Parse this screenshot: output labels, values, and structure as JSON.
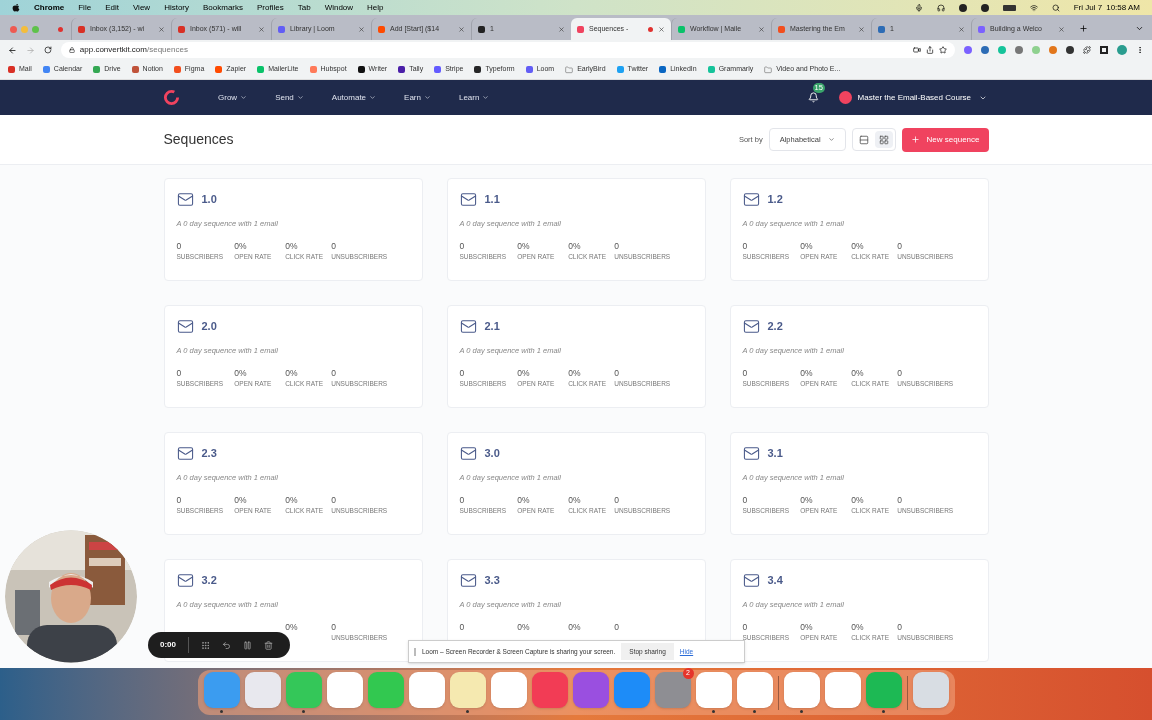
{
  "menu_bar": {
    "app": "Chrome",
    "items": [
      "File",
      "Edit",
      "View",
      "History",
      "Bookmarks",
      "Profiles",
      "Tab",
      "Window",
      "Help"
    ],
    "date": "Fri Jul 7",
    "time": "10:58 AM"
  },
  "tabs": [
    {
      "kind": "pinned",
      "color": "#e0312f",
      "selected": false
    },
    {
      "kind": "page",
      "title": "Inbox (3,152) - wi",
      "color": "#d93025",
      "recording": false,
      "selected": false
    },
    {
      "kind": "page",
      "title": "Inbox (571) - will",
      "color": "#d93025",
      "recording": false,
      "selected": false
    },
    {
      "kind": "page",
      "title": "Library | Loom",
      "color": "#625df5",
      "recording": false,
      "selected": false
    },
    {
      "kind": "page",
      "title": "Add [Start] ($14",
      "color": "#ff4a00",
      "recording": false,
      "selected": false
    },
    {
      "kind": "page",
      "title": "1",
      "color": "#222222",
      "recording": false,
      "selected": false
    },
    {
      "kind": "page",
      "title": "Sequences - ",
      "color": "#f0435f",
      "recording": true,
      "selected": true
    },
    {
      "kind": "page",
      "title": "Workflow | Maile",
      "color": "#09c269",
      "recording": false,
      "selected": false
    },
    {
      "kind": "page",
      "title": "Mastering the Em",
      "color": "#f24e1e",
      "recording": false,
      "selected": false
    },
    {
      "kind": "page",
      "title": "1",
      "color": "#2d6cb5",
      "recording": false,
      "selected": false
    },
    {
      "kind": "page",
      "title": "Building a Welco",
      "color": "#7b61ff",
      "recording": false,
      "selected": false
    }
  ],
  "address_bar": {
    "host": "app.convertkit.com",
    "path": "/sequences"
  },
  "bookmarks": [
    {
      "kind": "site",
      "label": "Mail",
      "color": "#d93025"
    },
    {
      "kind": "site",
      "label": "Calendar",
      "color": "#4285f4"
    },
    {
      "kind": "site",
      "label": "Drive",
      "color": "#34a853"
    },
    {
      "kind": "site",
      "label": "Notion",
      "color": "#c0533a"
    },
    {
      "kind": "site",
      "label": "Figma",
      "color": "#f24e1e"
    },
    {
      "kind": "site",
      "label": "Zapier",
      "color": "#ff4a00"
    },
    {
      "kind": "site",
      "label": "MailerLite",
      "color": "#09c269"
    },
    {
      "kind": "site",
      "label": "Hubspot",
      "color": "#ff7a59"
    },
    {
      "kind": "site",
      "label": "Writer",
      "color": "#111111"
    },
    {
      "kind": "site",
      "label": "Tally",
      "color": "#4b1fa8"
    },
    {
      "kind": "site",
      "label": "Stripe",
      "color": "#635bff"
    },
    {
      "kind": "site",
      "label": "Typeform",
      "color": "#262627"
    },
    {
      "kind": "site",
      "label": "Loom",
      "color": "#625df5"
    },
    {
      "kind": "folder",
      "label": "EarlyBird"
    },
    {
      "kind": "site",
      "label": "Twitter",
      "color": "#1da1f2"
    },
    {
      "kind": "site",
      "label": "LinkedIn",
      "color": "#0a66c2"
    },
    {
      "kind": "site",
      "label": "Grammarly",
      "color": "#15c39a"
    },
    {
      "kind": "folder",
      "label": "Video and Photo E..."
    }
  ],
  "nav": {
    "items": [
      "Grow",
      "Send",
      "Automate",
      "Earn",
      "Learn"
    ],
    "notifications": "15",
    "account": "Master the Email-Based Course"
  },
  "header": {
    "title": "Sequences",
    "sort_label": "Sort by",
    "sort_value": "Alphabetical",
    "views": [
      {
        "kind": "list",
        "selected": false
      },
      {
        "kind": "grid",
        "selected": true
      }
    ],
    "new_button": "New sequence"
  },
  "sequences": [
    {
      "title": "1.0",
      "description": "A 0 day sequence with 1 email",
      "stats": [
        {
          "kind": "subscribers",
          "value": "0",
          "label": "SUBSCRIBERS"
        },
        {
          "kind": "open_rate",
          "value": "0%",
          "label": "OPEN RATE"
        },
        {
          "kind": "click_rate",
          "value": "0%",
          "label": "CLICK RATE"
        },
        {
          "kind": "unsubscribers",
          "value": "0",
          "label": "UNSUBSCRIBERS"
        }
      ]
    },
    {
      "title": "1.1",
      "description": "A 0 day sequence with 1 email",
      "stats": [
        {
          "kind": "subscribers",
          "value": "0",
          "label": "SUBSCRIBERS"
        },
        {
          "kind": "open_rate",
          "value": "0%",
          "label": "OPEN RATE"
        },
        {
          "kind": "click_rate",
          "value": "0%",
          "label": "CLICK RATE"
        },
        {
          "kind": "unsubscribers",
          "value": "0",
          "label": "UNSUBSCRIBERS"
        }
      ]
    },
    {
      "title": "1.2",
      "description": "A 0 day sequence with 1 email",
      "stats": [
        {
          "kind": "subscribers",
          "value": "0",
          "label": "SUBSCRIBERS"
        },
        {
          "kind": "open_rate",
          "value": "0%",
          "label": "OPEN RATE"
        },
        {
          "kind": "click_rate",
          "value": "0%",
          "label": "CLICK RATE"
        },
        {
          "kind": "unsubscribers",
          "value": "0",
          "label": "UNSUBSCRIBERS"
        }
      ]
    },
    {
      "title": "2.0",
      "description": "A 0 day sequence with 1 email",
      "stats": [
        {
          "kind": "subscribers",
          "value": "0",
          "label": "SUBSCRIBERS"
        },
        {
          "kind": "open_rate",
          "value": "0%",
          "label": "OPEN RATE"
        },
        {
          "kind": "click_rate",
          "value": "0%",
          "label": "CLICK RATE"
        },
        {
          "kind": "unsubscribers",
          "value": "0",
          "label": "UNSUBSCRIBERS"
        }
      ]
    },
    {
      "title": "2.1",
      "description": "A 0 day sequence with 1 email",
      "stats": [
        {
          "kind": "subscribers",
          "value": "0",
          "label": "SUBSCRIBERS"
        },
        {
          "kind": "open_rate",
          "value": "0%",
          "label": "OPEN RATE"
        },
        {
          "kind": "click_rate",
          "value": "0%",
          "label": "CLICK RATE"
        },
        {
          "kind": "unsubscribers",
          "value": "0",
          "label": "UNSUBSCRIBERS"
        }
      ]
    },
    {
      "title": "2.2",
      "description": "A 0 day sequence with 1 email",
      "stats": [
        {
          "kind": "subscribers",
          "value": "0",
          "label": "SUBSCRIBERS"
        },
        {
          "kind": "open_rate",
          "value": "0%",
          "label": "OPEN RATE"
        },
        {
          "kind": "click_rate",
          "value": "0%",
          "label": "CLICK RATE"
        },
        {
          "kind": "unsubscribers",
          "value": "0",
          "label": "UNSUBSCRIBERS"
        }
      ]
    },
    {
      "title": "2.3",
      "description": "A 0 day sequence with 1 email",
      "stats": [
        {
          "kind": "subscribers",
          "value": "0",
          "label": "SUBSCRIBERS"
        },
        {
          "kind": "open_rate",
          "value": "0%",
          "label": "OPEN RATE"
        },
        {
          "kind": "click_rate",
          "value": "0%",
          "label": "CLICK RATE"
        },
        {
          "kind": "unsubscribers",
          "value": "0",
          "label": "UNSUBSCRIBERS"
        }
      ]
    },
    {
      "title": "3.0",
      "description": "A 0 day sequence with 1 email",
      "stats": [
        {
          "kind": "subscribers",
          "value": "0",
          "label": "SUBSCRIBERS"
        },
        {
          "kind": "open_rate",
          "value": "0%",
          "label": "OPEN RATE"
        },
        {
          "kind": "click_rate",
          "value": "0%",
          "label": "CLICK RATE"
        },
        {
          "kind": "unsubscribers",
          "value": "0",
          "label": "UNSUBSCRIBERS"
        }
      ]
    },
    {
      "title": "3.1",
      "description": "A 0 day sequence with 1 email",
      "stats": [
        {
          "kind": "subscribers",
          "value": "0",
          "label": "SUBSCRIBERS"
        },
        {
          "kind": "open_rate",
          "value": "0%",
          "label": "OPEN RATE"
        },
        {
          "kind": "click_rate",
          "value": "0%",
          "label": "CLICK RATE"
        },
        {
          "kind": "unsubscribers",
          "value": "0",
          "label": "UNSUBSCRIBERS"
        }
      ]
    },
    {
      "title": "3.2",
      "description": "A 0 day sequence with 1 email",
      "stats": [
        {
          "kind": "click_rate",
          "value": "0%"
        },
        {
          "kind": "unsubscribers",
          "value": "0",
          "label": "UNSUBSCRIBERS"
        }
      ]
    },
    {
      "title": "3.3",
      "description": "A 0 day sequence with 1 email",
      "stats": [
        {
          "kind": "subscribers",
          "value": "0"
        },
        {
          "kind": "open_rate",
          "value": "0%"
        },
        {
          "kind": "click_rate",
          "value": "0%"
        },
        {
          "kind": "unsubscribers",
          "value": "0"
        }
      ]
    },
    {
      "title": "3.4",
      "description": "A 0 day sequence with 1 email",
      "stats": [
        {
          "kind": "subscribers",
          "value": "0",
          "label": "SUBSCRIBERS"
        },
        {
          "kind": "open_rate",
          "value": "0%",
          "label": "OPEN RATE"
        },
        {
          "kind": "click_rate",
          "value": "0%",
          "label": "CLICK RATE"
        },
        {
          "kind": "unsubscribers",
          "value": "0",
          "label": "UNSUBSCRIBERS"
        }
      ]
    }
  ],
  "recorder": {
    "time": "0:00"
  },
  "sharing_bar": {
    "message": "Loom – Screen Recorder & Screen Capture is sharing your screen.",
    "stop": "Stop sharing",
    "hide": "Hide"
  },
  "dock": [
    {
      "color": "#3b9cf0",
      "running": true
    },
    {
      "color": "#e8e8ee",
      "running": false
    },
    {
      "color": "#34c759",
      "running": true
    },
    {
      "color": "#ffffff",
      "running": false
    },
    {
      "color": "#32c850",
      "running": false
    },
    {
      "color": "#ffffff",
      "running": false
    },
    {
      "color": "#f5e9b0",
      "running": true
    },
    {
      "color": "#ffffff",
      "running": false
    },
    {
      "color": "#f23c55",
      "running": false
    },
    {
      "color": "#9a4fe0",
      "running": false
    },
    {
      "color": "#1d8cf8",
      "running": false
    },
    {
      "color": "#8e8e93",
      "running": false,
      "badge": "2"
    },
    {
      "color": "#ffffff",
      "running": true
    },
    {
      "color": "#ffffff",
      "running": true
    },
    {
      "kind": "separator"
    },
    {
      "color": "#ffffff",
      "running": true
    },
    {
      "color": "#ffffff",
      "running": false
    },
    {
      "color": "#1db954",
      "running": true
    },
    {
      "kind": "separator"
    },
    {
      "color": "#d8dde3",
      "running": false
    }
  ]
}
